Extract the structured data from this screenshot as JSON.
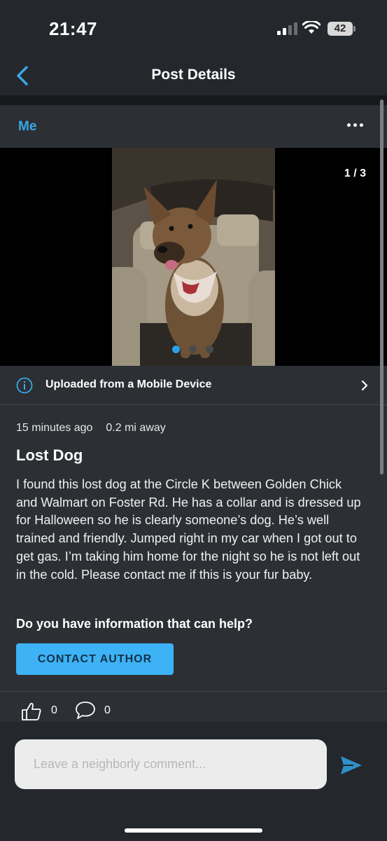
{
  "status_bar": {
    "time": "21:47",
    "battery": "42"
  },
  "header": {
    "title": "Post Details"
  },
  "author": {
    "name": "Me"
  },
  "photo": {
    "counter": "1 / 3",
    "total_images": 3,
    "active_index": 0
  },
  "upload_info": {
    "text": "Uploaded from a Mobile Device"
  },
  "post": {
    "time_ago": "15 minutes ago",
    "distance": "0.2 mi away",
    "title": "Lost Dog",
    "body": "I found this lost dog at the Circle K between Golden Chick and Walmart on Foster Rd. He has a collar and is dressed up for Halloween so he is clearly someone’s dog. He’s well trained and friendly. Jumped right in my car when I got out to get gas. I’m taking him home for the night so he is not left out in the cold. Please contact me if this is your fur baby.",
    "help_question": "Do you have information that can help?",
    "contact_label": "CONTACT AUTHOR"
  },
  "reactions": {
    "likes": "0",
    "comments": "0"
  },
  "comment_bar": {
    "placeholder": "Leave a neighborly comment..."
  },
  "colors": {
    "accent": "#3db2f5",
    "background": "#24272c",
    "card": "#2c2f34"
  }
}
